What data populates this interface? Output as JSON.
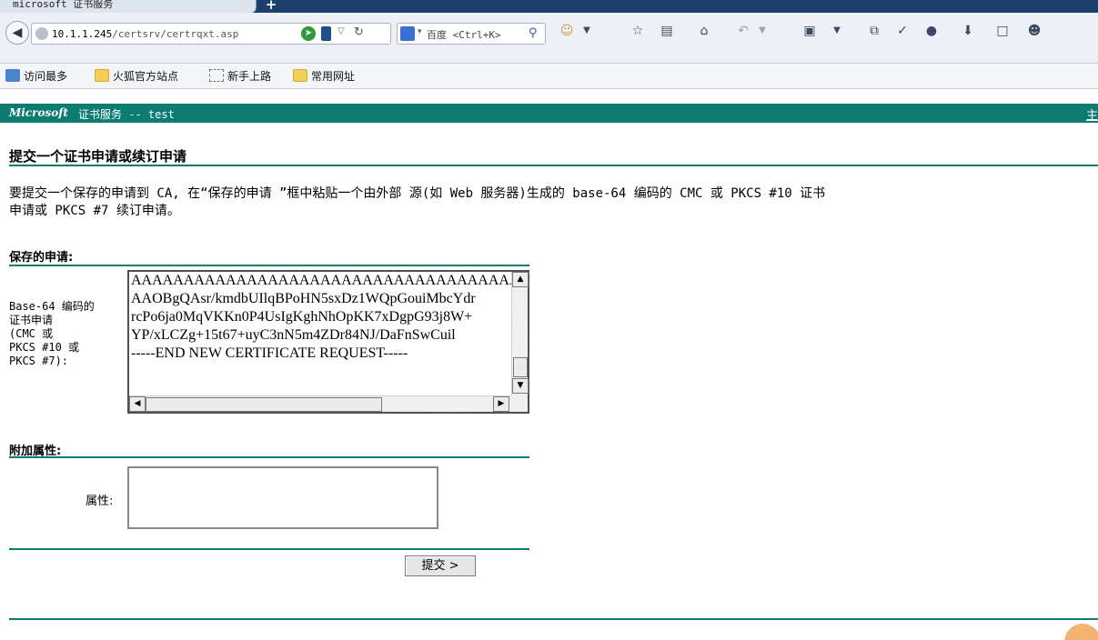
{
  "browser": {
    "tab_title": "microsoft 证书服务",
    "new_tab_label": "+",
    "url_host": "10.1.1.245",
    "url_path": "/certsrv/certrqxt.asp",
    "search_placeholder": "百度 <Ctrl+K>",
    "toolbar_icons": [
      "emoji-icon",
      "dropdown-icon",
      "star-icon",
      "reading-list-icon",
      "home-icon",
      "undo-icon",
      "crop-icon",
      "share-icon",
      "brush-icon",
      "mask-icon",
      "download-icon",
      "window-icon",
      "user-icon"
    ]
  },
  "bookmarks": [
    {
      "label": "访问最多",
      "icon": "search-bookmark-icon"
    },
    {
      "label": "火狐官方站点",
      "icon": "folder-icon"
    },
    {
      "label": "新手上路",
      "icon": "dotted-page-icon"
    },
    {
      "label": "常用网址",
      "icon": "folder-icon"
    }
  ],
  "brand": {
    "microsoft": "Microsoft",
    "rest": "证书服务 -- test",
    "home_link": "主"
  },
  "page": {
    "title": "提交一个证书申请或续订申请",
    "intro_line1": "要提交一个保存的申请到 CA, 在“保存的申请 ”框中粘贴一个由外部 源(如 Web 服务器)生成的 base-64 编码的 CMC 或 PKCS #10 证书",
    "intro_line2": "申请或 PKCS #7 续订申请。",
    "saved_request_heading": "保存的申请:",
    "request_label": "Base-64 编码的\n证书申请\n(CMC 或\nPKCS #10 或\nPKCS #7):",
    "request_value": "AAAAAAAAAAAAAAAAAAAAAAAAAAAAAAAAAAAAAAAAAAAA\nAAOBgQAsr/kmdbUIlqBPoHN5sxDz1WQpGouiMbcYdr\nrcPo6ja0MqVKKn0P4UsIgKghNhOpKK7xDgpG93j8W+\nYP/xLCZg+15t67+uyC3nN5m4ZDr84NJ/DaFnSwCuil\n-----END NEW CERTIFICATE REQUEST-----",
    "attributes_heading": "附加属性:",
    "attributes_label": "属性:",
    "attributes_value": "",
    "submit_label": "提交 >"
  }
}
